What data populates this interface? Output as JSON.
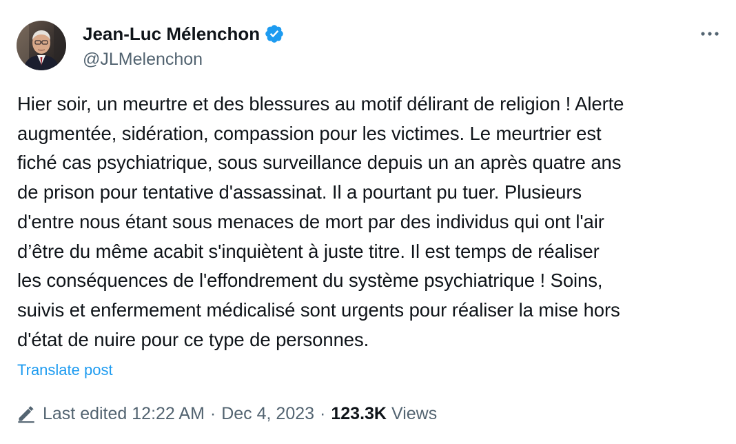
{
  "author": {
    "name": "Jean-Luc Mélenchon",
    "handle": "@JLMelenchon",
    "verified": true
  },
  "tweet": {
    "text": "Hier soir, un meurtre et des blessures au motif délirant de religion ! Alerte\naugmentée, sidération, compassion pour les victimes. Le meurtrier est\nfiché cas psychiatrique, sous surveillance depuis un an après quatre ans\nde prison pour tentative d'assassinat. Il a pourtant pu tuer. Plusieurs\nd'entre nous étant sous menaces de mort par des individus qui ont l'air\nd’être du même acabit s'inquiètent à juste titre. Il est temps de réaliser\nles conséquences de l'effondrement du système psychiatrique ! Soins,\nsuivis et enfermement médicalisé sont urgents pour réaliser la mise hors\nd'état de nuire pour ce type de personnes.",
    "translate_label": "Translate post"
  },
  "meta": {
    "edited_label": "Last edited 12:22 AM",
    "separator": "·",
    "date": "Dec 4, 2023",
    "views_count": "123.3K",
    "views_label": "Views"
  },
  "icons": {
    "verified": "verified-badge-icon",
    "more": "more-horizontal-icon",
    "edit": "pencil-icon"
  },
  "colors": {
    "text": "#0f1419",
    "secondary": "#536471",
    "link": "#1d9bf0"
  }
}
